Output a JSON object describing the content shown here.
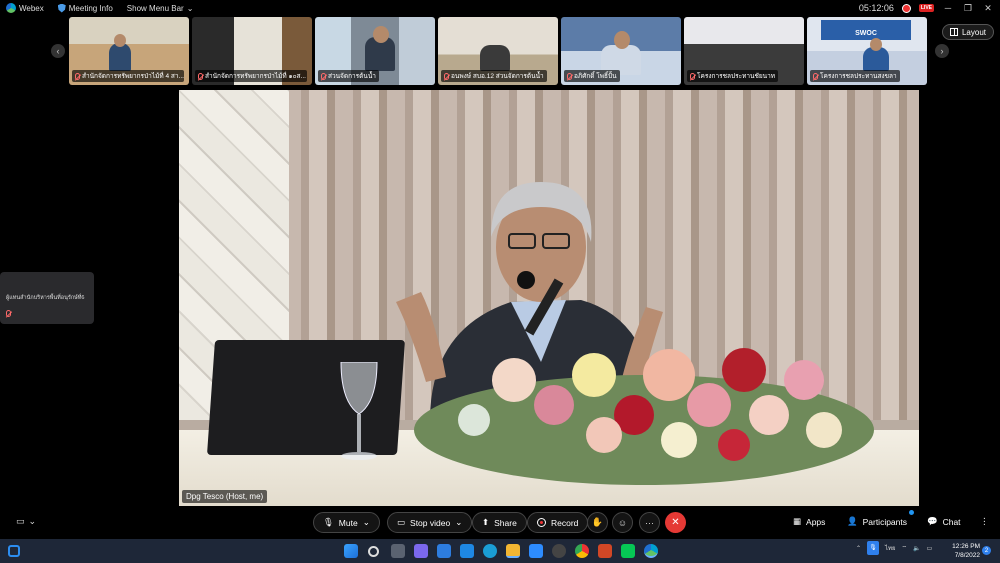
{
  "window": {
    "app_name": "Webex",
    "meeting_info_label": "Meeting Info",
    "menu_bar_label": "Show Menu Bar",
    "timer": "05:12:06",
    "live_label": "LIVE",
    "minimize": "─",
    "restore": "❐",
    "close": "✕"
  },
  "layout_button": "Layout",
  "thumbnails": [
    {
      "label": "สำนักจัดการทรัพยากรป่าไม้ที่ 4 สา..."
    },
    {
      "label": "สำนักจัดการทรัพยากรป่าไม้ที่ ๑๐ส..."
    },
    {
      "label": "ส่วนจัดการต้นน้ำ"
    },
    {
      "label": "อนพงษ์ สบอ.12 ส่วนจัดการต้นน้ำ"
    },
    {
      "label": "อภิศักดิ์ โพธิ์ปั้น"
    },
    {
      "label": "โครงการชลประทานชัยนาท"
    },
    {
      "label": "โครงการชลประทานสงขลา",
      "banner": "SWOC"
    }
  ],
  "main_video": {
    "name_tag": "Dpg Tesco (Host, me)"
  },
  "side_participant": {
    "name": "ผู้แทนสำนักบริหารพื้นที่อนุรักษ์ที่6"
  },
  "controls": {
    "mute": "Mute",
    "stop_video": "Stop video",
    "share": "Share",
    "record": "Record",
    "more": "···",
    "apps": "Apps",
    "participants": "Participants",
    "chat": "Chat"
  },
  "taskbar": {
    "time": "12:26 PM",
    "date": "7/8/2022",
    "lang": "ไทย",
    "notification_count": "2"
  },
  "colors": {
    "end_button": "#e53935",
    "record_dot": "#e33333",
    "taskbar": "#1e2738",
    "accent": "#2196f3"
  }
}
